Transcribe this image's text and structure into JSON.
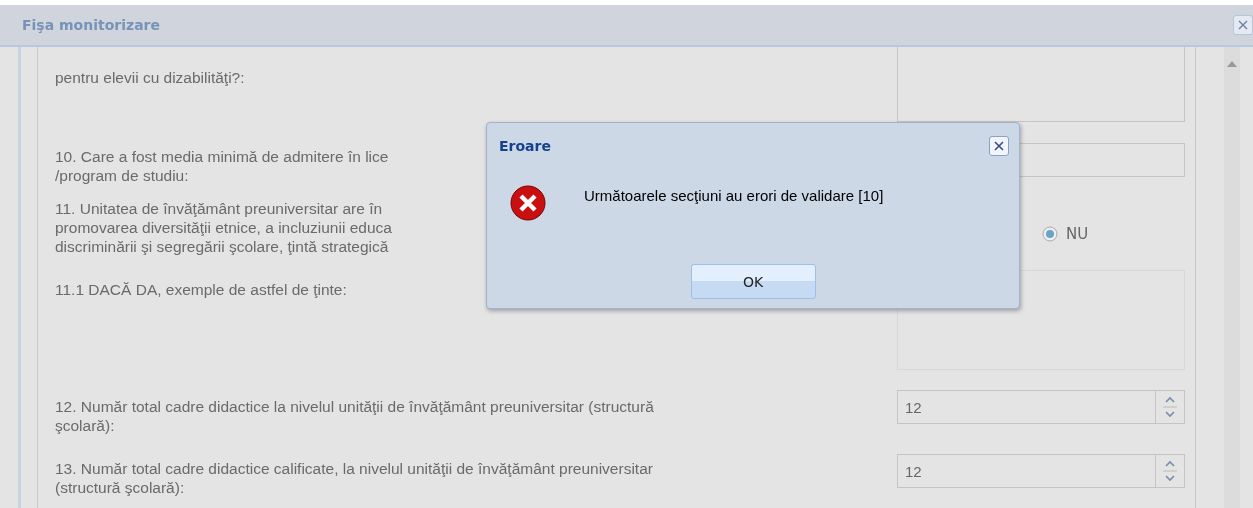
{
  "window": {
    "title": "Fişa monitorizare"
  },
  "questions": [
    {
      "kind": "textarea",
      "label": [
        "pentru elevii cu dizabilităţi?:"
      ]
    },
    {
      "kind": "text",
      "label": [
        "10. Care a fost media minimă de admitere în lice",
        "/program de studiu:"
      ]
    },
    {
      "kind": "radio",
      "label": [
        "11. Unitatea de învăţământ preuniversitar are în",
        "promovarea diversităţii etnice, a incluziunii educa",
        "discriminării şi segregării şcolare, ţintă strategică"
      ],
      "options": [
        {
          "label": "NU",
          "selected": true
        }
      ]
    },
    {
      "kind": "textarea",
      "label": [
        "11.1 DACĂ DA, exemple de astfel de ţinte:"
      ],
      "disabled": true
    },
    {
      "kind": "spin",
      "label": [
        "12. Număr total cadre didactice la nivelul unităţii de învăţământ preuniversitar (structură",
        "şcolară):"
      ],
      "value": "12"
    },
    {
      "kind": "spin",
      "label": [
        "13. Număr total cadre didactice calificate, la nivelul unităţii de învăţământ preuniversitar",
        "(structură şcolară):"
      ],
      "value": "12"
    }
  ],
  "dialog": {
    "title": "Eroare",
    "message": "Următoarele secţiuni au erori de validare [10]",
    "button": "OK"
  }
}
